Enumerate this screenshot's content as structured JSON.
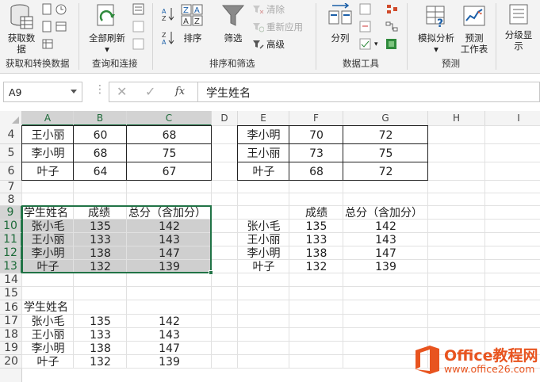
{
  "ribbon": {
    "groups": {
      "get_data": "获取和转换数据",
      "queries": "查询和连接",
      "sort_filter": "排序和筛选",
      "data_tools": "数据工具",
      "forecast": "预测"
    },
    "get_data_line1": "获取数",
    "get_data_line2": "据",
    "refresh_all": "全部刷新",
    "sort": "排序",
    "filter": "筛选",
    "clear": "清除",
    "reapply": "重新应用",
    "advanced": "高级",
    "split_column": "分列",
    "what_if": "模拟分析",
    "forecast_line1": "预测",
    "forecast_line2": "工作表",
    "outline_line1": "分级显",
    "outline_line2": "示"
  },
  "formula_bar": {
    "name_box": "A9",
    "fx": "fx",
    "content": "学生姓名"
  },
  "columns": [
    "A",
    "B",
    "C",
    "D",
    "E",
    "F",
    "G",
    "H",
    "I"
  ],
  "rows": [
    "4",
    "5",
    "6",
    "7",
    "8",
    "9",
    "10",
    "11",
    "12",
    "13",
    "14",
    "15",
    "16",
    "17",
    "18",
    "19",
    "20"
  ],
  "cells": {
    "A4": "王小丽",
    "B4": "60",
    "C4": "68",
    "E4": "李小明",
    "F4": "70",
    "G4": "72",
    "A5": "李小明",
    "B5": "68",
    "C5": "75",
    "E5": "王小丽",
    "F5": "73",
    "G5": "75",
    "A6": "叶子",
    "B6": "64",
    "C6": "67",
    "E6": "叶子",
    "F6": "68",
    "G6": "72",
    "A9": "学生姓名",
    "B9": "成绩",
    "C9": "总分（含加分）",
    "F9": "成绩",
    "G9": "总分（含加分）",
    "A10": "张小毛",
    "B10": "135",
    "C10": "142",
    "E10": "张小毛",
    "F10": "135",
    "G10": "142",
    "A11": "王小丽",
    "B11": "133",
    "C11": "143",
    "E11": "王小丽",
    "F11": "133",
    "G11": "143",
    "A12": "李小明",
    "B12": "138",
    "C12": "147",
    "E12": "李小明",
    "F12": "138",
    "G12": "147",
    "A13": "叶子",
    "B13": "132",
    "C13": "139",
    "E13": "叶子",
    "F13": "132",
    "G13": "139",
    "A16": "学生姓名",
    "A17": "张小毛",
    "B17": "135",
    "C17": "142",
    "A18": "王小丽",
    "B18": "133",
    "C18": "143",
    "A19": "李小明",
    "B19": "138",
    "C19": "147",
    "A20": "叶子",
    "B20": "132",
    "C20": "139"
  },
  "watermark": {
    "title": "Office教程网",
    "url": "www.office26.com"
  },
  "colors": {
    "accent": "#217346",
    "selection_fill": "#cfcfcf",
    "watermark": "#e8541f"
  }
}
